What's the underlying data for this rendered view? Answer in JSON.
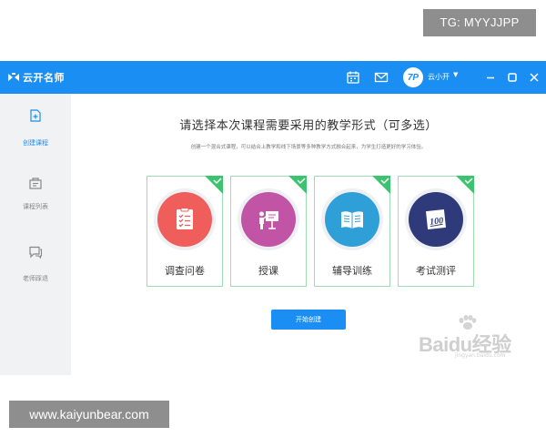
{
  "overlay": {
    "tg_badge": "TG: MYYJJPP",
    "url_badge": "www.kaiyunbear.com"
  },
  "titlebar": {
    "app_name": "云开名师",
    "username": "云小开",
    "avatar_text": "7P",
    "accent_color": "#1a8ef2",
    "icons": [
      "calendar-icon",
      "mail-icon",
      "minimize-icon",
      "maximize-icon",
      "close-icon"
    ]
  },
  "sidebar": {
    "items": [
      {
        "label": "创建课程",
        "icon": "add-course-icon",
        "active": true
      },
      {
        "label": "课程列表",
        "icon": "course-list-icon",
        "active": false
      },
      {
        "label": "老师踩退",
        "icon": "chat-icon",
        "active": false
      }
    ]
  },
  "main": {
    "title": "请选择本次课程需要采用的教学形式（可多选）",
    "description": "创建一个混合式课程，可以结合上教学和线下场景等多种教学方式融合起来，为学生打造更好的学习体验。",
    "cards": [
      {
        "label": "调查问卷",
        "color": "#f05e5b",
        "icon": "survey-icon",
        "selected": true
      },
      {
        "label": "授课",
        "color": "#c254a6",
        "icon": "teaching-icon",
        "selected": true
      },
      {
        "label": "辅导训练",
        "color": "#2f9fd8",
        "icon": "tutoring-icon",
        "selected": true
      },
      {
        "label": "考试测评",
        "color": "#2f3a7a",
        "icon": "exam-icon",
        "selected": true
      }
    ],
    "exam_badge": "100",
    "start_button": "开始创建"
  },
  "watermark": {
    "text": "Baidu经验",
    "sub": "jingyan.baidu.com"
  }
}
